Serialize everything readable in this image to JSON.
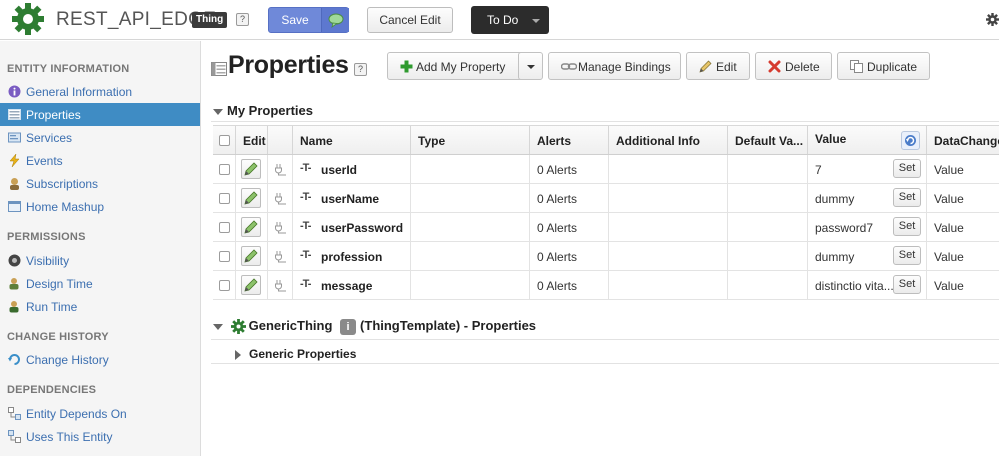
{
  "header": {
    "entity_name": "REST_API_EDGE",
    "badge": "Thing",
    "help": "?",
    "save_label": "Save",
    "cancel_label": "Cancel Edit",
    "todo_label": "To Do"
  },
  "sidebar": {
    "sections": [
      {
        "title": "ENTITY INFORMATION",
        "items": [
          {
            "label": "General Information",
            "icon": "info-icon"
          },
          {
            "label": "Properties",
            "icon": "properties-icon",
            "active": true
          },
          {
            "label": "Services",
            "icon": "services-icon"
          },
          {
            "label": "Events",
            "icon": "lightning-icon"
          },
          {
            "label": "Subscriptions",
            "icon": "subscriptions-icon"
          },
          {
            "label": "Home Mashup",
            "icon": "mashup-icon"
          }
        ]
      },
      {
        "title": "PERMISSIONS",
        "items": [
          {
            "label": "Visibility",
            "icon": "visibility-icon"
          },
          {
            "label": "Design Time",
            "icon": "design-time-icon"
          },
          {
            "label": "Run Time",
            "icon": "run-time-icon"
          }
        ]
      },
      {
        "title": "CHANGE HISTORY",
        "items": [
          {
            "label": "Change History",
            "icon": "history-icon"
          }
        ]
      },
      {
        "title": "DEPENDENCIES",
        "items": [
          {
            "label": "Entity Depends On",
            "icon": "depends-icon"
          },
          {
            "label": "Uses This Entity",
            "icon": "uses-icon"
          }
        ]
      }
    ]
  },
  "main": {
    "title": "Properties",
    "help": "?",
    "toolbar": {
      "add": "Add My Property",
      "bindings": "Manage Bindings",
      "edit": "Edit",
      "delete": "Delete",
      "duplicate": "Duplicate"
    },
    "my_properties_title": "My Properties",
    "columns": [
      "Edit",
      "Name",
      "Type",
      "Alerts",
      "Additional Info",
      "Default Va...",
      "Value",
      "DataChange"
    ],
    "rows": [
      {
        "name": "userId",
        "alerts": "0 Alerts",
        "value": "7",
        "set": "Set",
        "datachange": "Value"
      },
      {
        "name": "userName",
        "alerts": "0 Alerts",
        "value": "dummy",
        "set": "Set",
        "datachange": "Value"
      },
      {
        "name": "userPassword",
        "alerts": "0 Alerts",
        "value": "password7",
        "set": "Set",
        "datachange": "Value"
      },
      {
        "name": "profession",
        "alerts": "0 Alerts",
        "value": "dummy",
        "set": "Set",
        "datachange": "Value"
      },
      {
        "name": "message",
        "alerts": "0 Alerts",
        "value": "distinctio vita...",
        "set": "Set",
        "datachange": "Value"
      }
    ],
    "type_glyph": "-T-",
    "template": {
      "name": "GenericThing",
      "info_icon": "i",
      "suffix": "(ThingTemplate) - Properties",
      "generic_props": "Generic Properties"
    }
  },
  "colors": {
    "accent": "#3f8cc4",
    "link": "#3c6fb0",
    "save": "#6f89d9",
    "logo_green": "#2e7d32"
  }
}
